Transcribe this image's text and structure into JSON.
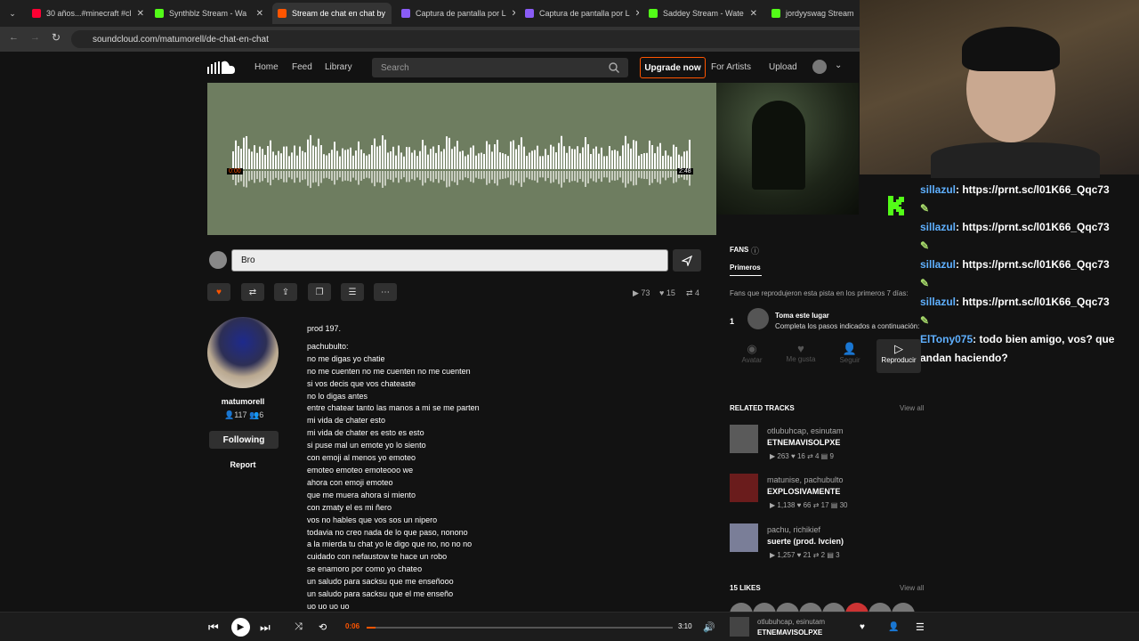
{
  "browser": {
    "tabs": [
      {
        "title": "30 años...#minecraft #cl",
        "color": "#ff0033",
        "active": false
      },
      {
        "title": "Synthblz Stream - Wa",
        "color": "#53fc18",
        "active": false
      },
      {
        "title": "Stream de chat en chat by",
        "color": "#ff5500",
        "active": true
      },
      {
        "title": "Captura de pantalla por L",
        "color": "#8a5cf6",
        "active": false
      },
      {
        "title": "Captura de pantalla por L",
        "color": "#8a5cf6",
        "active": false
      },
      {
        "title": "Saddey Stream - Wate",
        "color": "#53fc18",
        "active": false
      },
      {
        "title": "jordyyswag Stream -",
        "color": "#53fc18",
        "active": false
      }
    ],
    "url": "soundcloud.com/matumorell/de-chat-en-chat"
  },
  "header": {
    "nav": [
      "Home",
      "Feed",
      "Library"
    ],
    "search_placeholder": "Search",
    "upgrade": "Upgrade now",
    "for_artists": "For Artists",
    "upload": "Upload"
  },
  "hero": {
    "time_start": "0:00",
    "time_end": "2:48"
  },
  "comment": {
    "value": "Bro"
  },
  "stats": {
    "plays": "73",
    "likes": "15",
    "reposts": "4"
  },
  "uploader": {
    "name": "matumorell",
    "followers": "117",
    "following_count": "6",
    "following_btn": "Following",
    "report": "Report"
  },
  "description": [
    "prod 197.",
    "",
    "pachubulto:",
    "no me digas yo chatie",
    "no me cuenten no me cuenten no me cuenten",
    "si vos decis que vos chateaste",
    "no lo digas antes",
    "entre chatear tanto las manos a mi se me parten",
    "mi vida de chater esto",
    "mi vida de chater es esto es esto",
    "si puse mal un emote yo lo siento",
    "con emoji al menos yo emoteo",
    "emoteo emoteo emoteooo we",
    "ahora con emoji emoteo",
    "que me muera ahora si miento",
    "con zmaty el es mi ñero",
    "vos no hables que vos sos un nipero",
    "todavia no creo nada de lo que paso, nonono",
    "a la mierda tu chat yo le digo que no, no no no",
    "cuidado con nefaustow te hace un robo",
    "se enamoro por como yo chateo",
    "un saludo para sacksu que me enseñooo",
    "un saludo para sacksu que el me enseño",
    "uo uo uo uo"
  ],
  "fans": {
    "title": "FANS",
    "tab": "Primeros",
    "subtitle": "Fans que reprodujeron esta pista en los primeros 7 días:",
    "rank": "1",
    "slot_title": "Toma este lugar",
    "slot_sub": "Completa los pasos indicados a continuación:",
    "steps": [
      "Avatar",
      "Me gusta",
      "Seguir",
      "Reproducir"
    ]
  },
  "related": {
    "title": "RELATED TRACKS",
    "view_all": "View all",
    "tracks": [
      {
        "artist": "otlubuhcap, esinutam",
        "name": "ETNEMAVISOLPXE",
        "plays": "263",
        "likes": "16",
        "reposts": "4",
        "comments": "9"
      },
      {
        "artist": "matunise, pachubulto",
        "name": "EXPLOSIVAMENTE",
        "plays": "1,138",
        "likes": "66",
        "reposts": "17",
        "comments": "30"
      },
      {
        "artist": "pachu, richikief",
        "name": "suerte (prod. lvcien)",
        "plays": "1,257",
        "likes": "21",
        "reposts": "2",
        "comments": "3"
      }
    ]
  },
  "likes_section": {
    "title": "15 LIKES",
    "view_all": "View all"
  },
  "chat": [
    {
      "user": "sillazul",
      "msg": ": https://prnt.sc/l01K66_Qqc73"
    },
    {
      "user": "sillazul",
      "msg": ": https://prnt.sc/l01K66_Qqc73"
    },
    {
      "user": "sillazul",
      "msg": ": https://prnt.sc/l01K66_Qqc73"
    },
    {
      "user": "sillazul",
      "msg": ": https://prnt.sc/l01K66_Qqc73"
    },
    {
      "user": "ElTony075",
      "msg": ": todo bien amigo, vos? que andan haciendo?"
    }
  ],
  "player": {
    "elapsed": "0:06",
    "duration": "3:10",
    "progress": 0.03,
    "artist": "otlubuhcap, esinutam",
    "title": "ETNEMAVISOLPXE"
  }
}
